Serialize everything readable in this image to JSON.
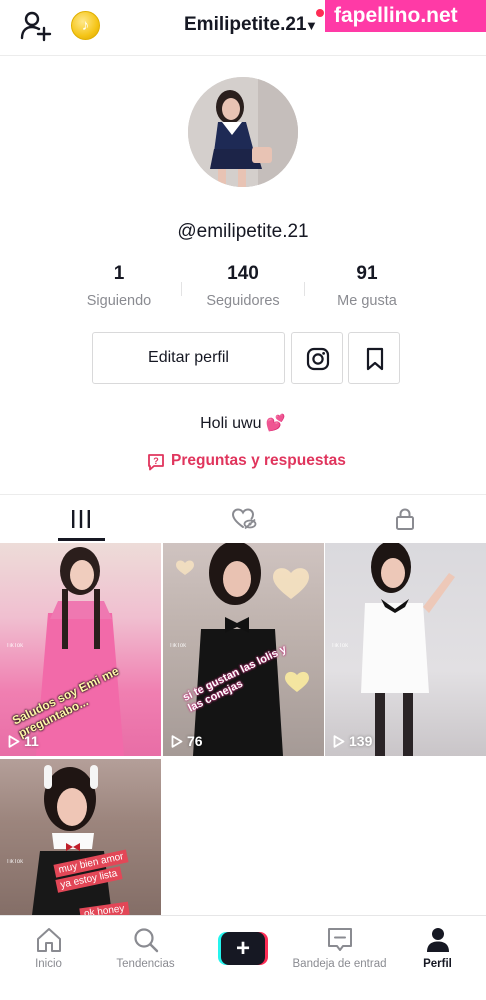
{
  "header": {
    "username": "Emilipetite.21",
    "coin_glyph": "♪",
    "watermark": "fapellino.net"
  },
  "profile": {
    "handle": "@emilipetite.21",
    "stats": [
      {
        "value": "1",
        "label": "Siguiendo"
      },
      {
        "value": "140",
        "label": "Seguidores"
      },
      {
        "value": "91",
        "label": "Me gusta"
      }
    ],
    "edit_button": "Editar perfil",
    "bio": "Holi uwu 💕",
    "qa_link": "Preguntas y respuestas"
  },
  "videos": [
    {
      "views": "11",
      "caption": "Saludos soy Emi me preguntabo...",
      "watermark": "TikTok"
    },
    {
      "views": "76",
      "caption": "si te gustan las lolis y las conejas",
      "watermark": "TikTok"
    },
    {
      "views": "139",
      "caption": "",
      "watermark": "TikTok"
    },
    {
      "views": "",
      "caption_lines": [
        "muy bien amor",
        "ya estoy lista",
        "ok honey"
      ],
      "watermark": "TikTok"
    }
  ],
  "bottom_nav": [
    {
      "label": "Inicio",
      "icon": "home-icon"
    },
    {
      "label": "Tendencias",
      "icon": "search-icon"
    },
    {
      "label": "",
      "icon": "create-plus-icon"
    },
    {
      "label": "Bandeja de entrad",
      "icon": "inbox-icon"
    },
    {
      "label": "Perfil",
      "icon": "profile-icon"
    }
  ],
  "colors": {
    "accent_red": "#fe2c55",
    "qa_pink": "#e0355d",
    "text_primary": "#161823",
    "text_secondary": "#8a8b91",
    "watermark_pink": "#ff3aa6",
    "plus_cyan": "#25f4ee"
  }
}
